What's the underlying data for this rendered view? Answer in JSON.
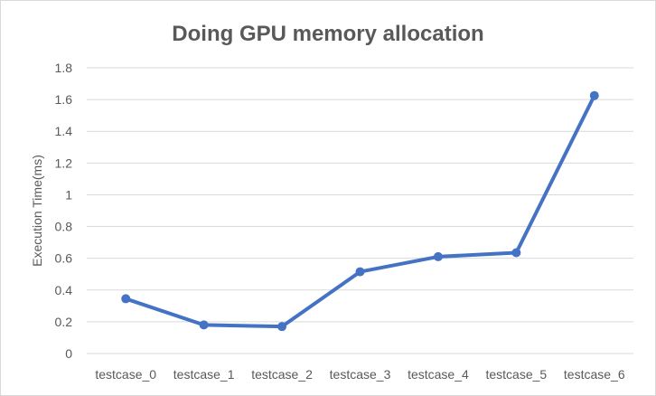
{
  "chart_data": {
    "type": "line",
    "title": "Doing GPU memory allocation",
    "xlabel": "",
    "ylabel": "Execution Time(ms)",
    "categories": [
      "testcase_0",
      "testcase_1",
      "testcase_2",
      "testcase_3",
      "testcase_4",
      "testcase_5",
      "testcase_6"
    ],
    "series": [
      {
        "values": [
          0.345,
          0.18,
          0.17,
          0.515,
          0.61,
          0.635,
          1.625
        ],
        "color": "#4472c4"
      }
    ],
    "ylim": [
      0,
      1.8
    ],
    "yticks": [
      0,
      0.2,
      0.4,
      0.6,
      0.8,
      1,
      1.2,
      1.4,
      1.6,
      1.8
    ],
    "ytick_labels": [
      "0",
      "0.2",
      "0.4",
      "0.6",
      "0.8",
      "1",
      "1.2",
      "1.4",
      "1.6",
      "1.8"
    ],
    "grid": true,
    "legend": "none",
    "colors": {
      "gridline": "#d9d9d9",
      "text": "#595959"
    }
  }
}
